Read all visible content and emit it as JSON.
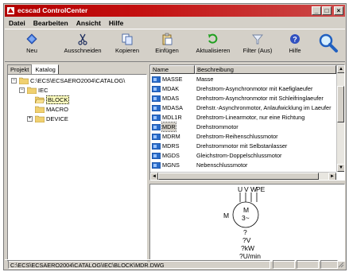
{
  "window": {
    "title": "ecscad ControlCenter"
  },
  "titlebar_buttons": {
    "minimize": "_",
    "maximize": "□",
    "close": "×"
  },
  "menu": [
    "Datei",
    "Bearbeiten",
    "Ansicht",
    "Hilfe"
  ],
  "toolbar": {
    "neu": "Neu",
    "ausschneiden": "Ausschneiden",
    "kopieren": "Kopieren",
    "einfuegen": "Einfügen",
    "aktualisieren": "Aktualisieren",
    "filter": "Filter (Aus)",
    "hilfe": "Hilfe"
  },
  "tabs": [
    "Projekt",
    "Katalog"
  ],
  "tree": {
    "root": "C:\\ECS\\ECSAERO2004\\CATALOG\\",
    "iec": "IEC",
    "block": "BLOCK",
    "macro": "MACRO",
    "device": "DEVICE"
  },
  "list": {
    "headers": {
      "name": "Name",
      "desc": "Beschreibung"
    },
    "rows": [
      {
        "name": "MASSE",
        "desc": "Masse"
      },
      {
        "name": "MDAK",
        "desc": "Drehstrom-Asynchronmotor mit Kaefiglaeufer"
      },
      {
        "name": "MDAS",
        "desc": "Drehstrom-Asynchronmotor mit Schleifringlaeufer"
      },
      {
        "name": "MDASA",
        "desc": "Drehstr.-Asynchronmotor, Anlaufwicklung im Laeufer"
      },
      {
        "name": "MDL1R",
        "desc": "Drehstrom-Linearmotor, nur eine Richtung"
      },
      {
        "name": "MDR",
        "desc": "Drehstrommotor"
      },
      {
        "name": "MDRM",
        "desc": "Drehstrom-Reihenschlussmotor"
      },
      {
        "name": "MDRS",
        "desc": "Drehstrommotor mit Selbstanlasser"
      },
      {
        "name": "MGDS",
        "desc": "Gleichstrom-Doppelschlussmotor"
      },
      {
        "name": "MGNS",
        "desc": "Nebenschlussmotor"
      }
    ]
  },
  "preview": {
    "terminals": [
      "U",
      "V",
      "W",
      "PE"
    ],
    "motor_letter": "M",
    "motor_inner": "M",
    "motor_phase": "3~",
    "motor_q": "?",
    "rating_v": "?V",
    "rating_kw": "?kW",
    "rating_rpm": "?U/min"
  },
  "statusbar": {
    "path": "C:\\ECS\\ECSAERO2004\\CATALOG\\IEC\\BLOCK\\MDR.DWG"
  }
}
